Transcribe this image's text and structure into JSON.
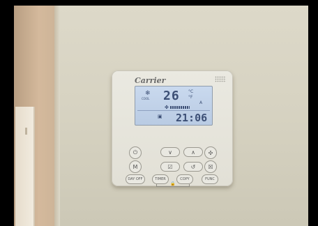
{
  "device": {
    "brand": "Carrier",
    "display": {
      "mode_icon": "snowflake-icon",
      "mode_text": "COOL",
      "set_temperature": "26",
      "unit_c": "°C",
      "unit_f": "°F",
      "fan_icon": "fan-icon",
      "fan_speed_indicator": "A",
      "timer_icon": "timer-icon",
      "clock": "21:06"
    },
    "buttons": {
      "power": "⏻",
      "down": "∨",
      "up": "∧",
      "fan": "✣",
      "mode": "M",
      "swing": "☑",
      "back": "↺",
      "check": "☒",
      "day_off": "DAY OFF",
      "timer": "TIMER",
      "copy": "COPY",
      "func": "FUNC",
      "lock": "🔒"
    }
  }
}
